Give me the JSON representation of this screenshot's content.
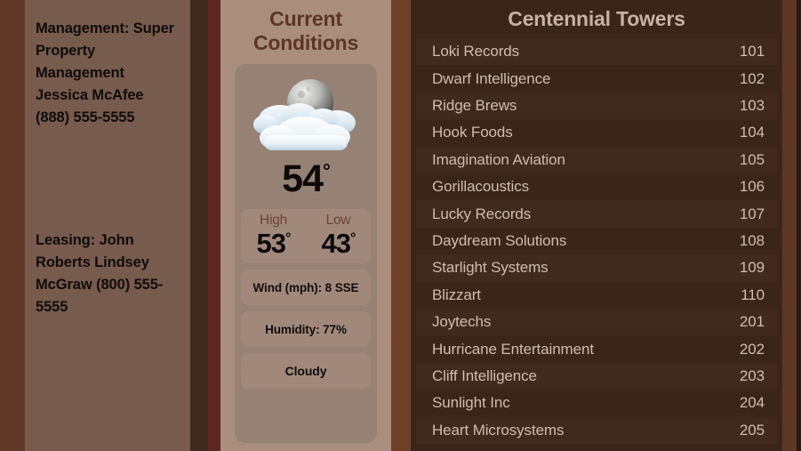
{
  "contacts": {
    "management": "Management: Super Property Management Jessica McAfee (888) 555-5555",
    "leasing": "Leasing: John Roberts Lindsey McGraw (800) 555-5555"
  },
  "weather": {
    "title": "Current Conditions",
    "icon": "moon-behind-clouds-icon",
    "current_temp": "54",
    "degree_symbol": "°",
    "high_label": "High",
    "low_label": "Low",
    "high_temp": "53",
    "low_temp": "43",
    "wind": "Wind (mph): 8 SSE",
    "humidity": "Humidity: 77%",
    "condition": "Cloudy"
  },
  "directory": {
    "title": "Centennial Towers",
    "rows": [
      {
        "name": "Loki Records",
        "unit": "101"
      },
      {
        "name": "Dwarf Intelligence",
        "unit": "102"
      },
      {
        "name": "Ridge Brews",
        "unit": "103"
      },
      {
        "name": "Hook Foods",
        "unit": "104"
      },
      {
        "name": "Imagination Aviation",
        "unit": "105"
      },
      {
        "name": "Gorillacoustics",
        "unit": "106"
      },
      {
        "name": "Lucky Records",
        "unit": "107"
      },
      {
        "name": "Daydream Solutions",
        "unit": "108"
      },
      {
        "name": "Starlight Systems",
        "unit": "109"
      },
      {
        "name": "Blizzart",
        "unit": "110"
      },
      {
        "name": "Joytechs",
        "unit": "201"
      },
      {
        "name": "Hurricane Entertainment",
        "unit": "202"
      },
      {
        "name": "Cliff Intelligence",
        "unit": "203"
      },
      {
        "name": "Sunlight Inc",
        "unit": "204"
      },
      {
        "name": "Heart Microsystems",
        "unit": "205"
      }
    ]
  },
  "colors": {
    "background_brown": "#5e3a27",
    "contacts_panel": "#775b4d",
    "weather_panel": "#a98e7d",
    "weather_card": "#968275",
    "directory_panel": "#3a2519",
    "directory_row_alt": "#402a1d",
    "accent_dark_brown": "#5c3526",
    "directory_text": "#cdbdb0"
  }
}
